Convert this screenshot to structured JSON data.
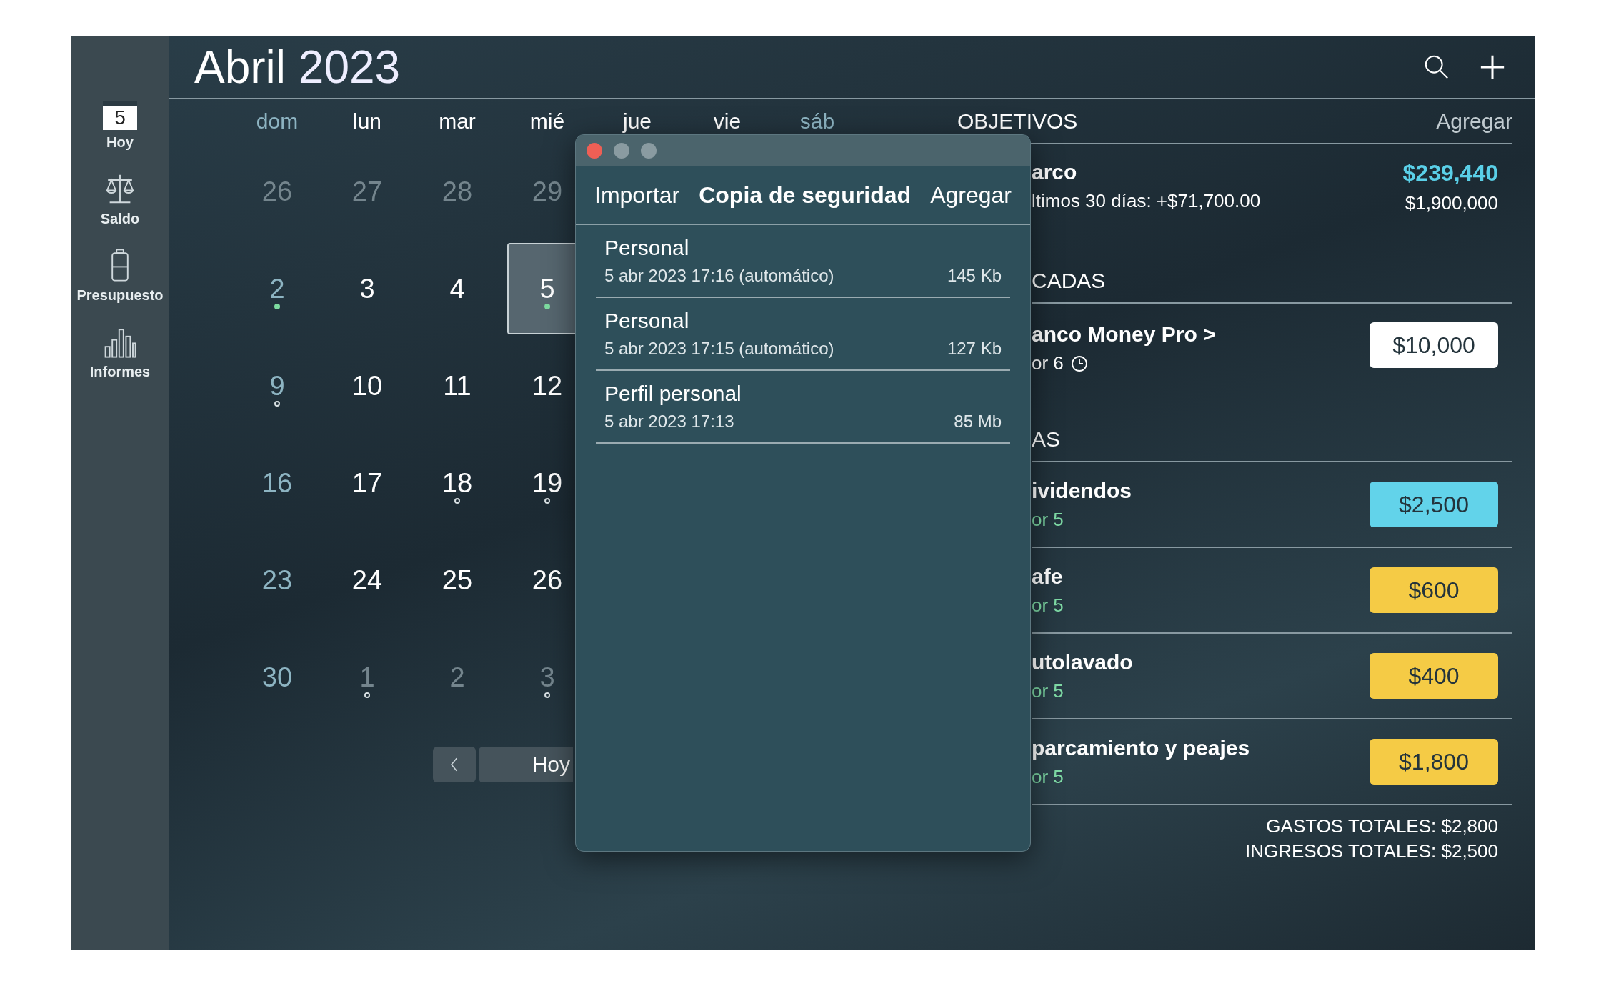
{
  "sidebar": {
    "items": [
      {
        "kind": "calendar",
        "icon_text": "5",
        "label": "Hoy"
      },
      {
        "kind": "scales",
        "label": "Saldo"
      },
      {
        "kind": "jar",
        "label": "Presupuesto"
      },
      {
        "kind": "chart",
        "label": "Informes"
      }
    ]
  },
  "header": {
    "month": "Abril",
    "year": "2023"
  },
  "calendar": {
    "weekdays": [
      {
        "label": "dom",
        "weekend": true
      },
      {
        "label": "lun",
        "weekend": false
      },
      {
        "label": "mar",
        "weekend": false
      },
      {
        "label": "mié",
        "weekend": false
      },
      {
        "label": "jue",
        "weekend": false
      },
      {
        "label": "vie",
        "weekend": false
      },
      {
        "label": "sáb",
        "weekend": true
      }
    ],
    "weeks": [
      [
        {
          "day": "26",
          "outside": true,
          "selected": false,
          "event": false
        },
        {
          "day": "27",
          "outside": true,
          "selected": false,
          "event": false
        },
        {
          "day": "28",
          "outside": true,
          "selected": false,
          "event": false
        },
        {
          "day": "29",
          "outside": true,
          "selected": false,
          "event": false
        }
      ],
      [
        {
          "day": "2",
          "outside": false,
          "selected": false,
          "event": true,
          "filled": true
        },
        {
          "day": "3",
          "outside": false,
          "selected": false,
          "event": false
        },
        {
          "day": "4",
          "outside": false,
          "selected": false,
          "event": false
        },
        {
          "day": "5",
          "outside": false,
          "selected": true,
          "event": true,
          "filled": true
        }
      ],
      [
        {
          "day": "9",
          "outside": false,
          "selected": false,
          "event": true,
          "filled": false
        },
        {
          "day": "10",
          "outside": false,
          "selected": false,
          "event": false
        },
        {
          "day": "11",
          "outside": false,
          "selected": false,
          "event": false
        },
        {
          "day": "12",
          "outside": false,
          "selected": false,
          "event": false
        }
      ],
      [
        {
          "day": "16",
          "outside": false,
          "selected": false,
          "event": false
        },
        {
          "day": "17",
          "outside": false,
          "selected": false,
          "event": false
        },
        {
          "day": "18",
          "outside": false,
          "selected": false,
          "event": true,
          "filled": false
        },
        {
          "day": "19",
          "outside": false,
          "selected": false,
          "event": true,
          "filled": false
        }
      ],
      [
        {
          "day": "23",
          "outside": false,
          "selected": false,
          "event": false
        },
        {
          "day": "24",
          "outside": false,
          "selected": false,
          "event": false
        },
        {
          "day": "25",
          "outside": false,
          "selected": false,
          "event": false
        },
        {
          "day": "26",
          "outside": false,
          "selected": false,
          "event": false
        }
      ],
      [
        {
          "day": "30",
          "outside": false,
          "selected": false,
          "event": false
        },
        {
          "day": "1",
          "outside": true,
          "selected": false,
          "event": true,
          "filled": false
        },
        {
          "day": "2",
          "outside": true,
          "selected": false,
          "event": false
        },
        {
          "day": "3",
          "outside": true,
          "selected": false,
          "event": true,
          "filled": false
        }
      ]
    ],
    "today_button": "Hoy"
  },
  "goals": {
    "title": "OBJETIVOS",
    "add": "Agregar",
    "items": [
      {
        "name": "arco",
        "detail": "ltimos 30 días: +$71,700.00",
        "amount": "$239,440",
        "target": "$1,900,000"
      }
    ]
  },
  "sections": [
    {
      "title": "CADAS",
      "items": [
        {
          "name": "anco Money Pro >",
          "detail": "or 6",
          "reminder": true,
          "amount": "$10,000",
          "kind": "transfer"
        }
      ]
    },
    {
      "title": "AS",
      "items": [
        {
          "name": "ividendos",
          "detail": "or 5",
          "reminder": false,
          "amount": "$2,500",
          "kind": "income"
        },
        {
          "name": "afe",
          "detail": "or 5",
          "reminder": false,
          "amount": "$600",
          "kind": "expense"
        },
        {
          "name": "utolavado",
          "detail": "or 5",
          "reminder": false,
          "amount": "$400",
          "kind": "expense"
        },
        {
          "name": "parcamiento y peajes",
          "detail": "or 5",
          "reminder": false,
          "amount": "$1,800",
          "kind": "expense"
        }
      ]
    }
  ],
  "totals": [
    "GASTOS TOTALES: $2,800",
    "INGRESOS TOTALES: $2,500"
  ],
  "dialog": {
    "tabs": [
      {
        "label": "Importar",
        "selected": false
      },
      {
        "label": "Copia de seguridad",
        "selected": true
      },
      {
        "label": "Agregar",
        "selected": false
      }
    ],
    "backups": [
      {
        "name": "Personal",
        "date": "5 abr 2023 17:16 (automático)",
        "size": "145 Kb"
      },
      {
        "name": "Personal",
        "date": "5 abr 2023 17:15 (automático)",
        "size": "127 Kb"
      },
      {
        "name": "Perfil personal",
        "date": "5 abr 2023 17:13",
        "size": "85 Mb"
      }
    ]
  }
}
